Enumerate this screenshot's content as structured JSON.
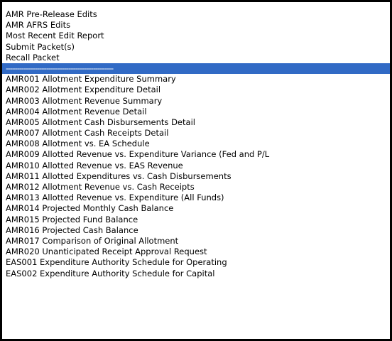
{
  "dropdown": {
    "items": [
      {
        "label": "AMR Pre-Release Edits",
        "selected": false
      },
      {
        "label": "AMR AFRS Edits",
        "selected": false
      },
      {
        "label": "Most Recent Edit Report",
        "selected": false
      },
      {
        "label": "Submit Packet(s)",
        "selected": false
      },
      {
        "label": "Recall Packet",
        "selected": false
      },
      {
        "label": "------------------------------------------------",
        "selected": true
      },
      {
        "label": "AMR001 Allotment Expenditure Summary",
        "selected": false
      },
      {
        "label": "AMR002 Allotment Expenditure Detail",
        "selected": false
      },
      {
        "label": "AMR003 Allotment Revenue Summary",
        "selected": false
      },
      {
        "label": "AMR004 Allotment Revenue Detail",
        "selected": false
      },
      {
        "label": "AMR005 Allotment Cash Disbursements Detail",
        "selected": false
      },
      {
        "label": "AMR007 Allotment Cash Receipts Detail",
        "selected": false
      },
      {
        "label": "AMR008 Allotment vs. EA Schedule",
        "selected": false
      },
      {
        "label": "AMR009 Allotted Revenue vs. Expenditure Variance (Fed and P/L",
        "selected": false
      },
      {
        "label": "AMR010 Allotted Revenue vs. EAS Revenue",
        "selected": false
      },
      {
        "label": "AMR011 Allotted Expenditures vs. Cash Disbursements",
        "selected": false
      },
      {
        "label": "AMR012 Allotment Revenue vs. Cash Receipts",
        "selected": false
      },
      {
        "label": "AMR013 Allotted Revenue vs. Expenditure (All Funds)",
        "selected": false
      },
      {
        "label": "AMR014 Projected Monthly Cash Balance",
        "selected": false
      },
      {
        "label": "AMR015 Projected Fund Balance",
        "selected": false
      },
      {
        "label": "AMR016 Projected Cash Balance",
        "selected": false
      },
      {
        "label": "AMR017 Comparison of Original Allotment",
        "selected": false
      },
      {
        "label": "AMR020 Unanticipated Receipt Approval Request",
        "selected": false
      },
      {
        "label": "EAS001 Expenditure Authority Schedule for Operating",
        "selected": false
      },
      {
        "label": "EAS002 Expenditure Authority Schedule for Capital",
        "selected": false
      }
    ]
  },
  "colors": {
    "selected_background": "#316ac5",
    "selected_text": "#ffffff",
    "border": "#000000"
  }
}
